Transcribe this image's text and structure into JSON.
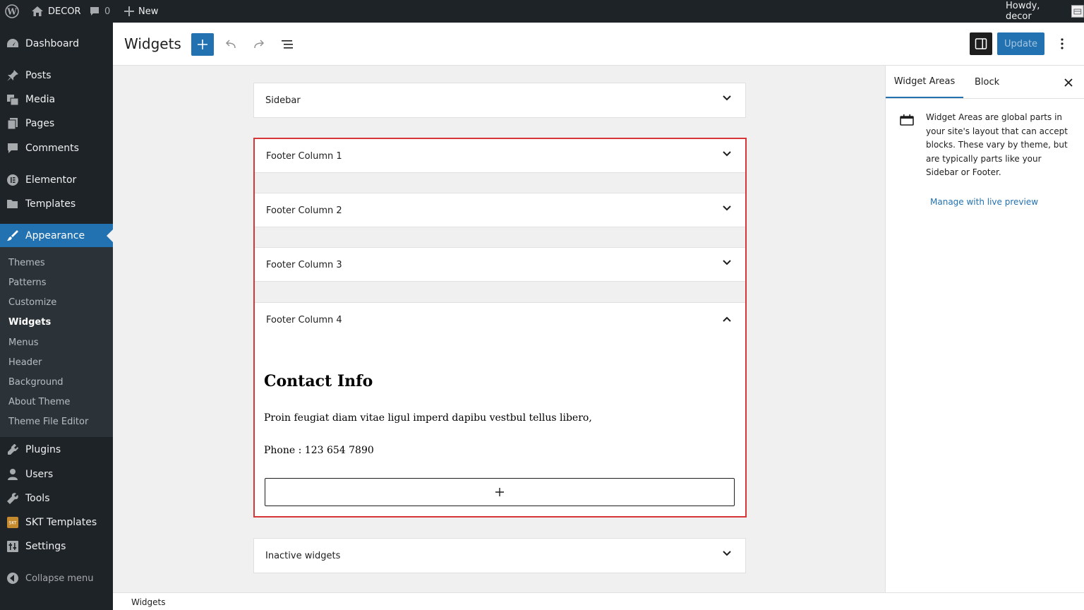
{
  "admin_bar": {
    "site_name": "DECOR",
    "comments_count": "0",
    "new_label": "New",
    "howdy": "Howdy, decor"
  },
  "menu": {
    "items": [
      {
        "label": "Dashboard",
        "icon": "dashboard-icon"
      },
      {
        "label": "Posts",
        "icon": "pin-icon"
      },
      {
        "label": "Media",
        "icon": "media-icon"
      },
      {
        "label": "Pages",
        "icon": "pages-icon"
      },
      {
        "label": "Comments",
        "icon": "comment-icon"
      },
      {
        "label": "Elementor",
        "icon": "elementor-icon"
      },
      {
        "label": "Templates",
        "icon": "folder-icon"
      },
      {
        "label": "Appearance",
        "icon": "brush-icon"
      },
      {
        "label": "Plugins",
        "icon": "plug-icon"
      },
      {
        "label": "Users",
        "icon": "user-icon"
      },
      {
        "label": "Tools",
        "icon": "wrench-icon"
      },
      {
        "label": "SKT Templates",
        "icon": "skt-icon"
      },
      {
        "label": "Settings",
        "icon": "sliders-icon"
      }
    ],
    "submenu": [
      "Themes",
      "Patterns",
      "Customize",
      "Widgets",
      "Menus",
      "Header",
      "Background",
      "About Theme",
      "Theme File Editor"
    ],
    "collapse_label": "Collapse menu"
  },
  "header": {
    "title": "Widgets",
    "update_label": "Update"
  },
  "areas": {
    "sidebar": "Sidebar",
    "footer1": "Footer Column 1",
    "footer2": "Footer Column 2",
    "footer3": "Footer Column 3",
    "footer4": "Footer Column 4",
    "inactive": "Inactive widgets"
  },
  "contact": {
    "title": "Contact Info",
    "text": "Proin feugiat diam vitae ligul imperd dapibu vestbul tellus libero,",
    "phone": "Phone : 123 654 7890"
  },
  "sidebar_panel": {
    "tab_widget_areas": "Widget Areas",
    "tab_block": "Block",
    "description": "Widget Areas are global parts in your site's layout that can accept blocks. These vary by theme, but are typically parts like your Sidebar or Footer.",
    "manage_link": "Manage with live preview"
  },
  "footer": {
    "breadcrumb": "Widgets"
  },
  "colors": {
    "accent": "#2271b1",
    "admin_dark": "#1d2327",
    "highlight_border": "#d63638"
  }
}
